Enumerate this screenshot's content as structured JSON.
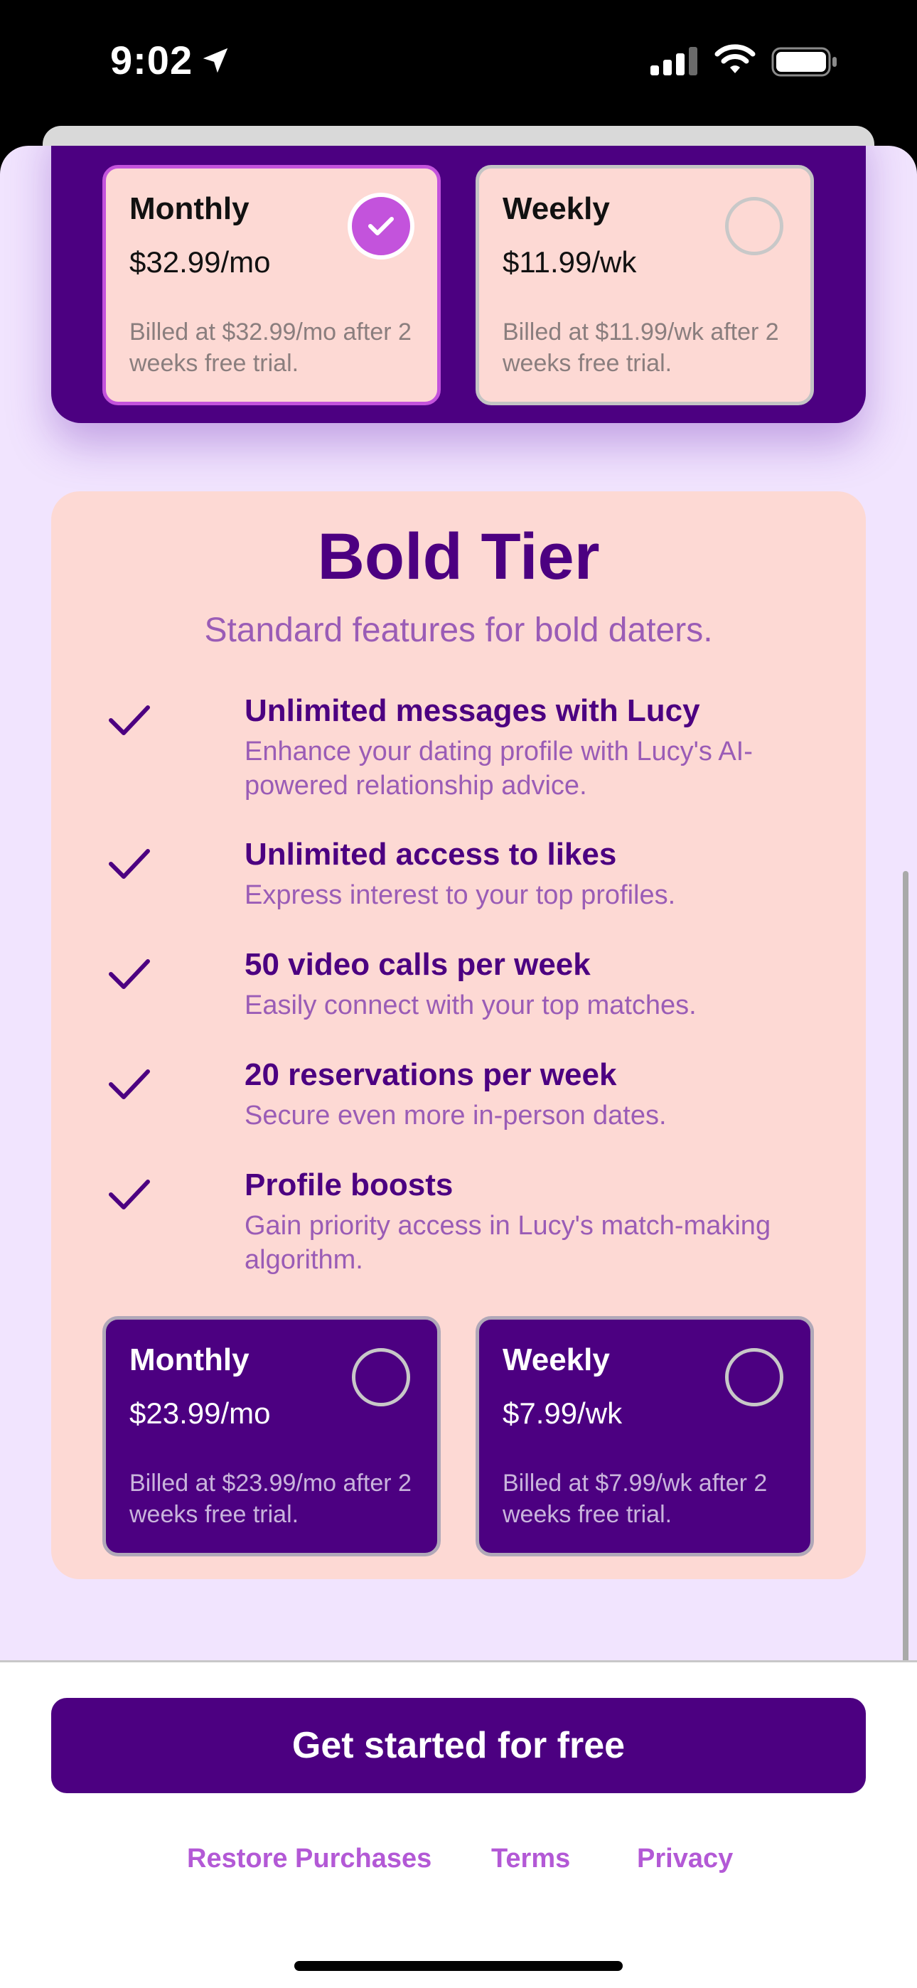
{
  "status_bar": {
    "time": "9:02"
  },
  "premium_plans": [
    {
      "title": "Monthly",
      "price": "$32.99/mo",
      "billed": "Billed at $32.99/mo after 2 weeks free trial.",
      "selected": true
    },
    {
      "title": "Weekly",
      "price": "$11.99/wk",
      "billed": "Billed at $11.99/wk after 2 weeks free trial.",
      "selected": false
    }
  ],
  "bold_tier": {
    "title": "Bold Tier",
    "subtitle": "Standard features for bold daters.",
    "features": [
      {
        "title": "Unlimited messages with Lucy",
        "desc": "Enhance your dating profile with Lucy's AI-powered relationship advice."
      },
      {
        "title": "Unlimited access to likes",
        "desc": "Express interest to your top profiles."
      },
      {
        "title": "50 video calls per week",
        "desc": "Easily connect with your top matches."
      },
      {
        "title": "20 reservations per week",
        "desc": "Secure even more in-person dates."
      },
      {
        "title": "Profile boosts",
        "desc": "Gain priority access in Lucy's match-making algorithm."
      }
    ],
    "plans": [
      {
        "title": "Monthly",
        "price": "$23.99/mo",
        "billed": "Billed at $23.99/mo after 2 weeks free trial.",
        "selected": false
      },
      {
        "title": "Weekly",
        "price": "$7.99/wk",
        "billed": "Billed at $7.99/wk after 2 weeks free trial.",
        "selected": false
      }
    ]
  },
  "cta": {
    "label": "Get started for free"
  },
  "footer": {
    "restore": "Restore Purchases",
    "terms": "Terms",
    "privacy": "Privacy"
  },
  "colors": {
    "primary": "#4c0081",
    "accent": "#c353dc",
    "card_bg": "#fdd9d4",
    "sheet_bg": "#f1e4fe",
    "muted_purple": "#9a5cb6",
    "link": "#b359d6"
  }
}
